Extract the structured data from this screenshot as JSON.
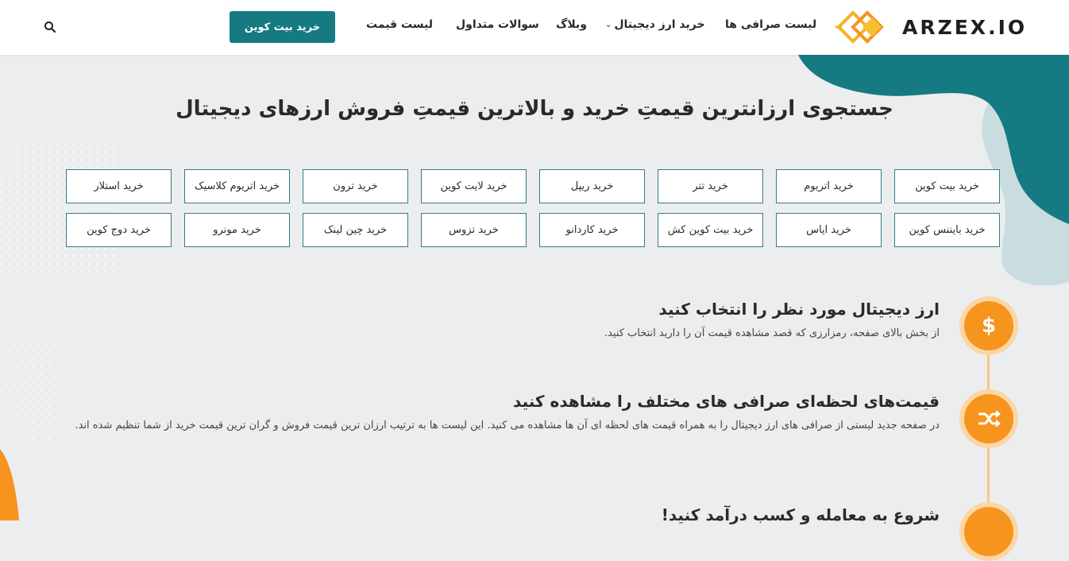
{
  "header": {
    "logo_text": "ARZEX.IO",
    "nav": [
      {
        "label": "لیست صرافی ها"
      },
      {
        "label": "خرید ارز دیجیتال",
        "has_dropdown": true
      },
      {
        "label": "وبلاگ"
      },
      {
        "label": "سوالات متداول"
      },
      {
        "label": "لیست قیمت"
      }
    ],
    "cta_label": "خرید بیت کوین",
    "search_icon": "search-icon"
  },
  "hero": {
    "title": "جستجوی ارزانترین قیمتِ خرید و بالاترین قیمتِ فروش ارزهای دیجیتال"
  },
  "coins": {
    "row1": [
      "خرید بیت کوین",
      "خرید اتریوم",
      "خرید تتر",
      "خرید ریپل",
      "خرید لایت کوین",
      "خرید ترون",
      "خرید اتریوم کلاسیک",
      "خرید استلار"
    ],
    "row2": [
      "خرید بایننس کوین",
      "خرید ایاس",
      "خرید بیت کوین کش",
      "خرید کاردانو",
      "خرید تزوس",
      "خرید چین لینک",
      "خرید مونرو",
      "خرید دوج کوین"
    ]
  },
  "steps": [
    {
      "title": "ارز دیجیتال مورد نظر را انتخاب کنید",
      "text": "از بخش بالای صفحه، رمزارزی که قصد مشاهده قیمت آن را دارید انتخاب کنید.",
      "icon": "dollar-icon",
      "glyph": "$"
    },
    {
      "title": "قیمت‌های لحظه‌ای صرافی های مختلف را مشاهده کنید",
      "text": "در صفحه جدید لیستی از صرافی های ارز دیجیتال را به همراه قیمت های لحظه ای آن ها مشاهده می کنید. این لیست ها به ترتیب ارزان ترین قیمت فروش و گران ترین قیمت خرید از شما تنظیم شده اند.",
      "icon": "shuffle-icon"
    },
    {
      "title": "شروع به معامله و کسب درآمد کنید!"
    }
  ],
  "colors": {
    "teal": "#167a83",
    "orange": "#f6941e",
    "background": "#ecedef"
  }
}
